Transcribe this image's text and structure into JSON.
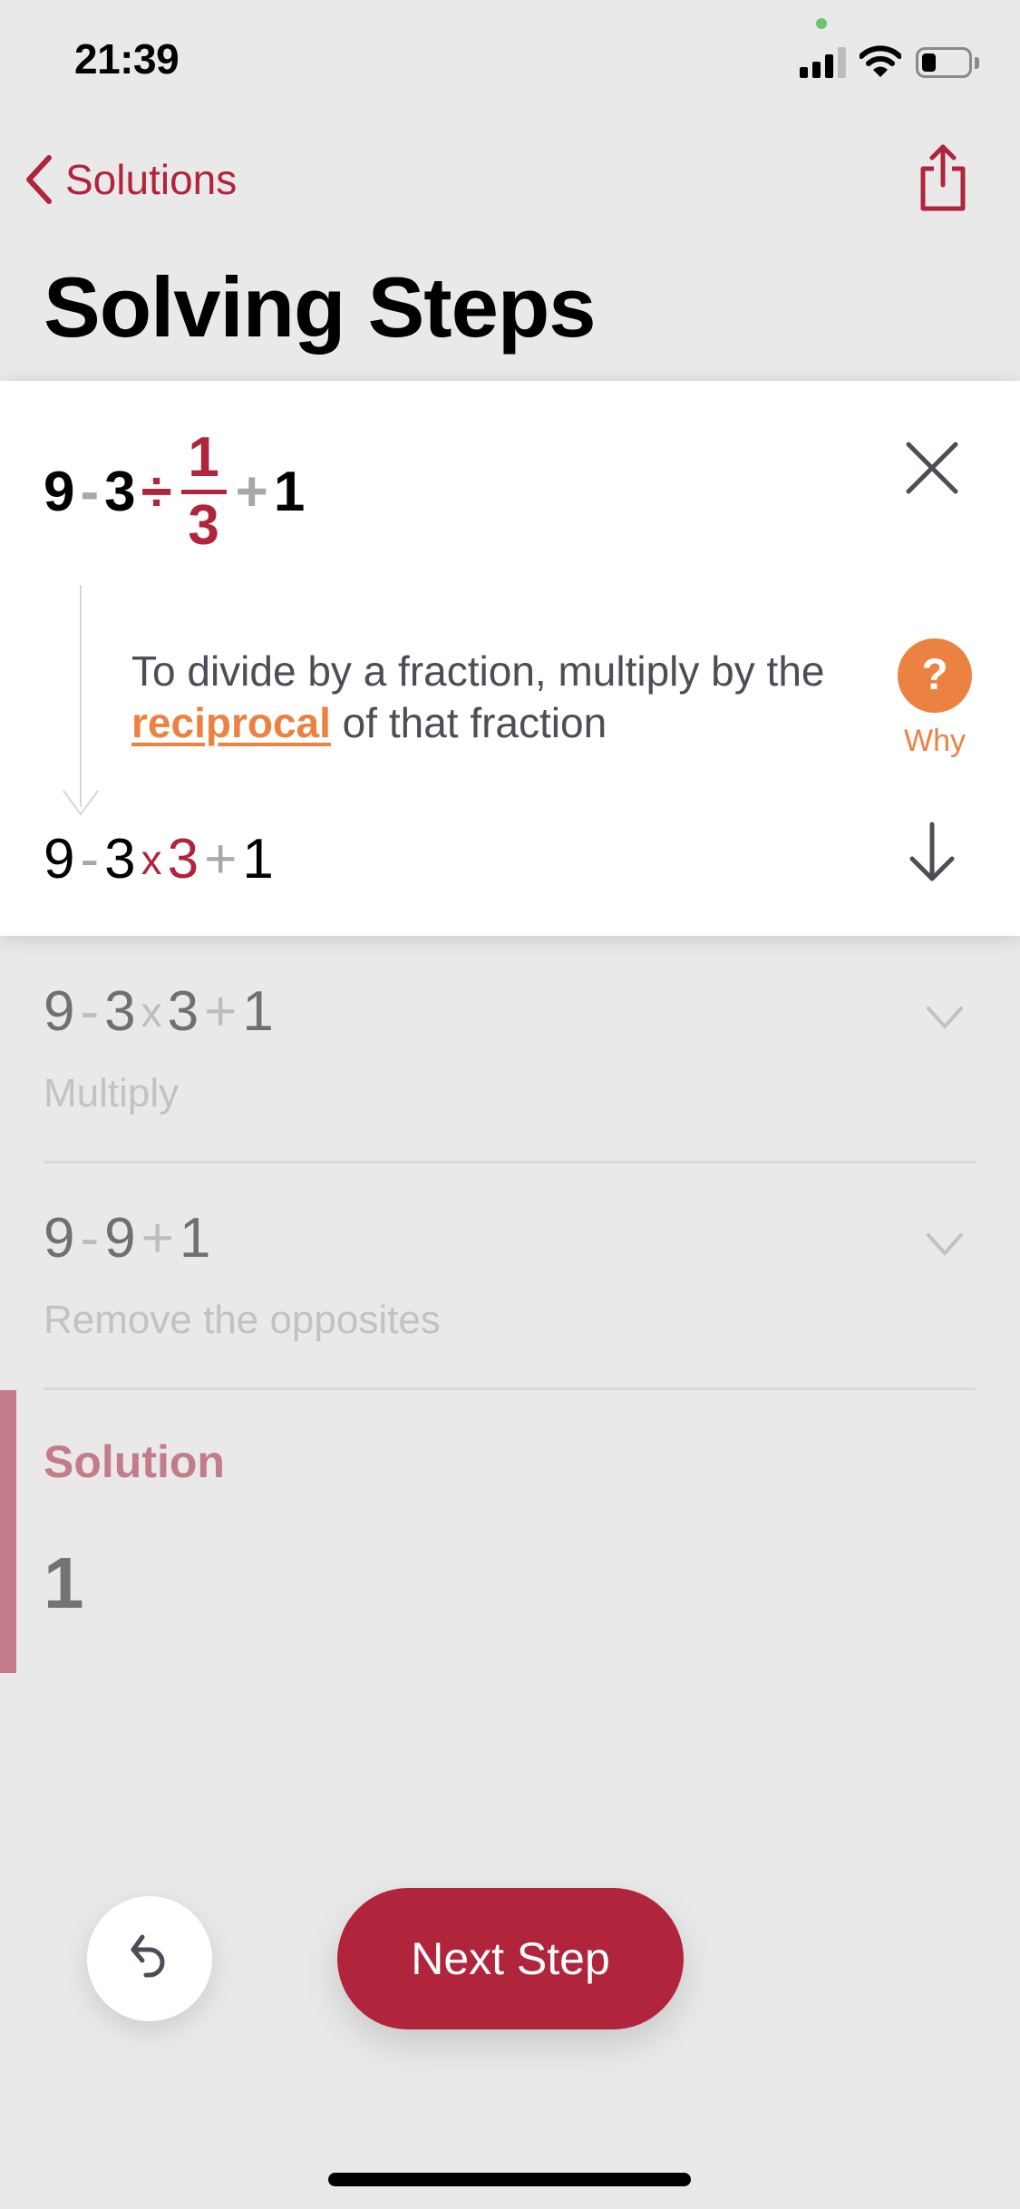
{
  "status_bar": {
    "time": "21:39",
    "battery_percent": 30,
    "signal_bars_active": 3,
    "signal_bars_total": 4
  },
  "nav": {
    "back_label": "Solutions",
    "back_icon": "chevron-left-icon",
    "share_icon": "share-icon"
  },
  "page_title": "Solving Steps",
  "colors": {
    "accent": "#b0253b",
    "why_orange": "#ec8242",
    "background": "#e9e9e9",
    "solution_pink": "#c47c8b"
  },
  "active_step": {
    "expression": {
      "a": "9",
      "op1": "-",
      "b": "3",
      "op2": "÷",
      "frac_num": "1",
      "frac_den": "3",
      "op3": "+",
      "c": "1"
    },
    "explanation": {
      "before": "To divide by a fraction, multiply by the ",
      "link": "reciprocal",
      "after": " of that fraction"
    },
    "why_label": "Why",
    "why_icon_glyph": "?",
    "result": {
      "a": "9",
      "op1": "-",
      "b": "3",
      "op2": "x",
      "c": "3",
      "op3": "+",
      "d": "1"
    }
  },
  "steps": [
    {
      "expression": {
        "a": "9",
        "op1": "-",
        "b": "3",
        "op2": "x",
        "c": "3",
        "op3": "+",
        "d": "1"
      },
      "description": "Multiply"
    },
    {
      "expression": {
        "a": "9",
        "op1": "-",
        "b": "9",
        "op2": "+",
        "c": "1"
      },
      "description": "Remove the opposites"
    }
  ],
  "solution": {
    "label": "Solution",
    "value": "1"
  },
  "bottom": {
    "next_step_label": "Next Step",
    "undo_icon": "undo-icon"
  }
}
